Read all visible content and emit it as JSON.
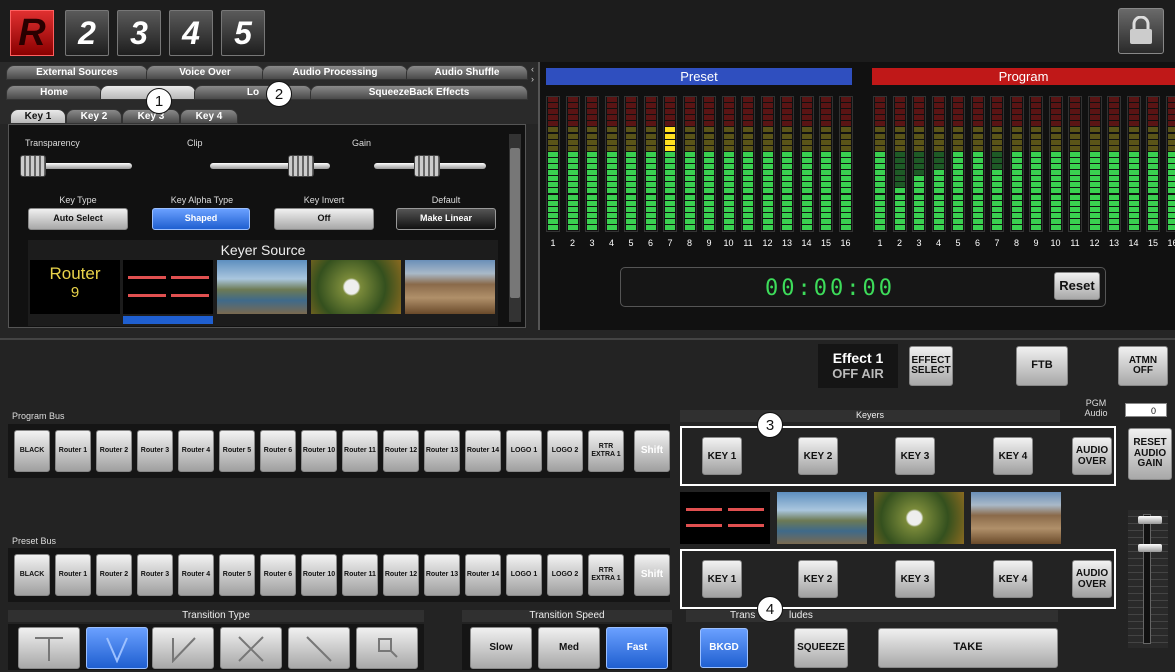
{
  "top": {
    "logo_letter": "R",
    "buttons": [
      "2",
      "3",
      "4",
      "5"
    ]
  },
  "tabs_row1": [
    "External Sources",
    "Voice Over",
    "Audio Processing",
    "Audio Shuffle"
  ],
  "tabs_row2": [
    "Home",
    "",
    "Lo",
    "SqueezeBack Effects"
  ],
  "key_tabs": [
    "Key 1",
    "Key 2",
    "Key 3",
    "Key 4"
  ],
  "sliders": {
    "transparency": "Transparency",
    "clip": "Clip",
    "gain": "Gain"
  },
  "key_settings": [
    {
      "label": "Key Type",
      "value": "Auto Select"
    },
    {
      "label": "Key Alpha Type",
      "value": "Shaped"
    },
    {
      "label": "Key Invert",
      "value": "Off"
    },
    {
      "label": "Default",
      "value": "Make Linear"
    }
  ],
  "keyer_source": {
    "title": "Keyer Source",
    "router_name": "Router",
    "router_num": "9"
  },
  "meters": {
    "preset_title": "Preset",
    "program_title": "Program",
    "channels": [
      "1",
      "2",
      "3",
      "4",
      "5",
      "6",
      "7",
      "8",
      "9",
      "10",
      "11",
      "12",
      "13",
      "14",
      "15",
      "16"
    ],
    "preset_levels": [
      0.62,
      0.62,
      0.62,
      0.62,
      0.62,
      0.62,
      0.78,
      0.62,
      0.62,
      0.62,
      0.62,
      0.62,
      0.62,
      0.62,
      0.62,
      0.62
    ],
    "program_levels": [
      0.62,
      0.36,
      0.42,
      0.48,
      0.62,
      0.62,
      0.48,
      0.62,
      0.62,
      0.62,
      0.62,
      0.62,
      0.62,
      0.62,
      0.62,
      0.62
    ]
  },
  "timer": {
    "value": "00:00:00",
    "reset": "Reset"
  },
  "effect": {
    "title": "Effect 1",
    "status": "OFF AIR",
    "select": "EFFECT SELECT",
    "ftb": "FTB",
    "atmn": "ATMN OFF"
  },
  "pgm_audio": {
    "label": "PGM Audio",
    "value": "0"
  },
  "reset_audio": "RESET AUDIO GAIN",
  "keyers": {
    "title": "Keyers",
    "buttons": [
      "KEY 1",
      "KEY 2",
      "KEY 3",
      "KEY 4",
      "AUDIO OVER"
    ]
  },
  "program_bus": {
    "title": "Program Bus",
    "buttons": [
      "BLACK",
      "Router 1",
      "Router 2",
      "Router 3",
      "Router 4",
      "Router 5",
      "Router 6",
      "Router 10",
      "Router 11",
      "Router 12",
      "Router 13",
      "Router 14",
      "LOGO 1",
      "LOGO 2",
      "RTR EXTRA 1"
    ],
    "active": "Router 11",
    "shift": "Shift"
  },
  "preset_bus": {
    "title": "Preset Bus",
    "buttons": [
      "BLACK",
      "Router 1",
      "Router 2",
      "Router 3",
      "Router 4",
      "Router 5",
      "Router 6",
      "Router 10",
      "Router 11",
      "Router 12",
      "Router 13",
      "Router 14",
      "LOGO 1",
      "LOGO 2",
      "RTR EXTRA 1"
    ],
    "active": "Router 10",
    "shift": "Shift"
  },
  "transition_type": {
    "title": "Transition Type"
  },
  "transition_speed": {
    "title": "Transition Speed",
    "options": [
      "Slow",
      "Med",
      "Fast"
    ],
    "active": "Fast"
  },
  "transition_includes": {
    "title": "Trans",
    "title_end": "ludes",
    "bkgd": "BKGD",
    "squeeze": "SQUEEZE",
    "take": "TAKE"
  },
  "callouts": [
    "1",
    "2",
    "3",
    "4"
  ],
  "colors": {
    "preset": "#2f4fbf",
    "program": "#c01818",
    "timer": "#3ddc5a",
    "active_blue": "#1f5fd0",
    "active_red": "#b01818"
  }
}
